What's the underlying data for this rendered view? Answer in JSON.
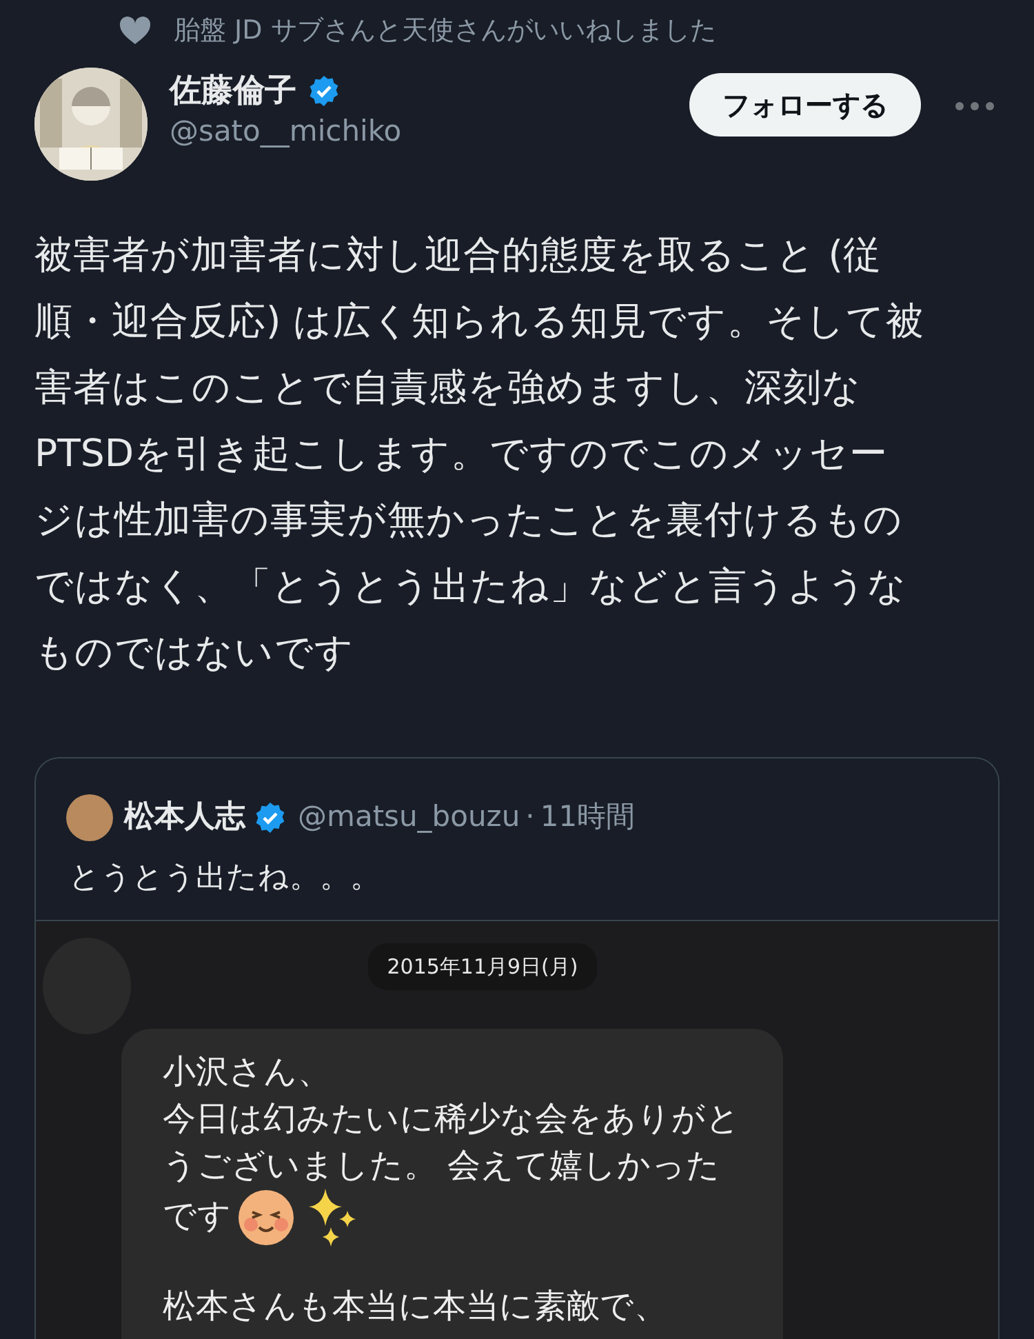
{
  "social_context": {
    "text": "胎盤 JD サブさんと天使さんがいいねしました"
  },
  "author": {
    "name": "佐藤倫子",
    "verified": true,
    "handle": "@sato__michiko"
  },
  "follow_button": {
    "label": "フォローする"
  },
  "post": {
    "text": "被害者が加害者に対し迎合的態度を取ること (従順・迎合反応) は広く知られる知見です。そして被害者はこのことで自責感を強めますし、深刻なPTSDを引き起こします。ですのでこのメッセージは性加害の事実が無かったことを裏付けるものではなく、「とうとう出たね」などと言うようなものではないです"
  },
  "quote": {
    "name": "松本人志",
    "verified": true,
    "handle": "@matsu_bouzu",
    "separator": "·",
    "time": "11時間",
    "text": "とうとう出たね。。。",
    "image": {
      "date": "2015年11月9日(月)",
      "lines": [
        {
          "text": "小沢さん、",
          "emoji": false,
          "gap_before": false
        },
        {
          "text": "今日は幻みたいに稀少な会をありがと",
          "emoji": false,
          "gap_before": false
        },
        {
          "text": "うございました。 会えて嬉しかった",
          "emoji": false,
          "gap_before": false
        },
        {
          "text": "です",
          "emoji": true,
          "gap_before": false
        },
        {
          "text": "松本さんも本当に本当に素敵で、",
          "emoji": false,
          "gap_before": true
        }
      ]
    }
  }
}
